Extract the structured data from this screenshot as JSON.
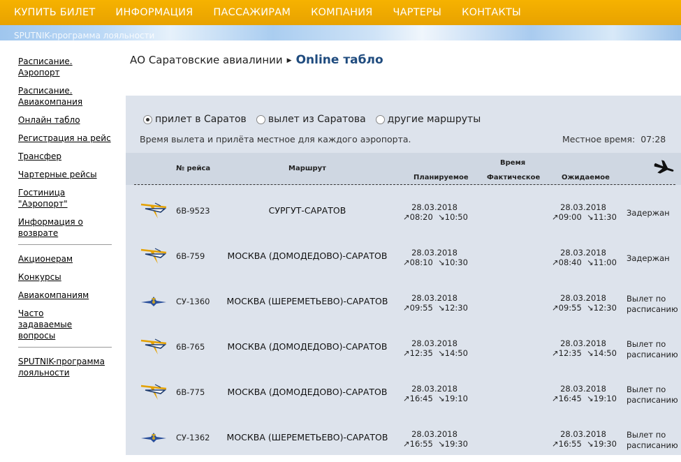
{
  "nav": [
    "КУПИТЬ БИЛЕТ",
    "ИНФОРМАЦИЯ",
    "ПАССАЖИРАМ",
    "КОМПАНИЯ",
    "ЧАРТЕРЫ",
    "КОНТАКТЫ"
  ],
  "banner_text": "SPUTNIK-программа лояльности",
  "sidebar": {
    "group1": [
      "Расписание. Аэропорт",
      "Расписание. Авиакомпания",
      "Онлайн табло",
      "Регистрация на рейс",
      "Трансфер",
      "Чартерные рейсы",
      "Гостиница \"Аэропорт\"",
      "Информация о возврате"
    ],
    "group2": [
      "Акционерам",
      "Конкурсы",
      "Авиакомпаниям",
      "Часто задаваемые вопросы"
    ],
    "group3": [
      "SPUTNIK-программа лояльности"
    ]
  },
  "breadcrumb": {
    "parent": "АО Саратовские авиалинии",
    "current": "Online табло"
  },
  "radios": [
    {
      "label": "прилет в Саратов",
      "checked": true
    },
    {
      "label": "вылет из Саратова",
      "checked": false
    },
    {
      "label": "другие маршруты",
      "checked": false
    }
  ],
  "note": "Время вылета и прилёта местное для каждого аэропорта.",
  "local_time": "Местное время:  07:28",
  "headers": {
    "flight": "№ рейса",
    "route": "Маршрут",
    "time": "Время",
    "planned": "Планируемое",
    "actual": "Фактическое",
    "expected": "Ожидаемое",
    "plane_icon": "plane-icon"
  },
  "colors": {
    "nav": "#f0ab00",
    "panel": "#dde3ec",
    "title": "#1f4b7e"
  },
  "flights": [
    {
      "logo": "saratov-airlines-logo",
      "number": "6В-9523",
      "route": "СУРГУТ-САРАТОВ",
      "planned_date": "28.03.2018",
      "planned_dep": "08:20",
      "planned_arr": "10:50",
      "expected_date": "28.03.2018",
      "expected_dep": "09:00",
      "expected_arr": "11:30",
      "status": [
        "Задержан"
      ]
    },
    {
      "logo": "saratov-airlines-logo",
      "number": "6В-759",
      "route": "МОСКВА (ДОМОДЕДОВО)-САРАТОВ",
      "planned_date": "28.03.2018",
      "planned_dep": "08:10",
      "planned_arr": "10:30",
      "expected_date": "28.03.2018",
      "expected_dep": "08:40",
      "expected_arr": "11:00",
      "status": [
        "Задержан"
      ]
    },
    {
      "logo": "aeroflot-logo",
      "number": "СУ-1360",
      "route": "МОСКВА (ШЕРЕМЕТЬЕВО)-САРАТОВ",
      "planned_date": "28.03.2018",
      "planned_dep": "09:55",
      "planned_arr": "12:30",
      "expected_date": "28.03.2018",
      "expected_dep": "09:55",
      "expected_arr": "12:30",
      "status": [
        "Вылет по",
        "расписанию"
      ]
    },
    {
      "logo": "saratov-airlines-logo",
      "number": "6В-765",
      "route": "МОСКВА (ДОМОДЕДОВО)-САРАТОВ",
      "planned_date": "28.03.2018",
      "planned_dep": "12:35",
      "planned_arr": "14:50",
      "expected_date": "28.03.2018",
      "expected_dep": "12:35",
      "expected_arr": "14:50",
      "status": [
        "Вылет по",
        "расписанию"
      ]
    },
    {
      "logo": "saratov-airlines-logo",
      "number": "6В-775",
      "route": "МОСКВА (ДОМОДЕДОВО)-САРАТОВ",
      "planned_date": "28.03.2018",
      "planned_dep": "16:45",
      "planned_arr": "19:10",
      "expected_date": "28.03.2018",
      "expected_dep": "16:45",
      "expected_arr": "19:10",
      "status": [
        "Вылет по",
        "расписанию"
      ]
    },
    {
      "logo": "aeroflot-logo",
      "number": "СУ-1362",
      "route": "МОСКВА (ШЕРЕМЕТЬЕВО)-САРАТОВ",
      "planned_date": "28.03.2018",
      "planned_dep": "16:55",
      "planned_arr": "19:30",
      "expected_date": "28.03.2018",
      "expected_dep": "16:55",
      "expected_arr": "19:30",
      "status": [
        "Вылет по",
        "расписанию"
      ]
    }
  ]
}
